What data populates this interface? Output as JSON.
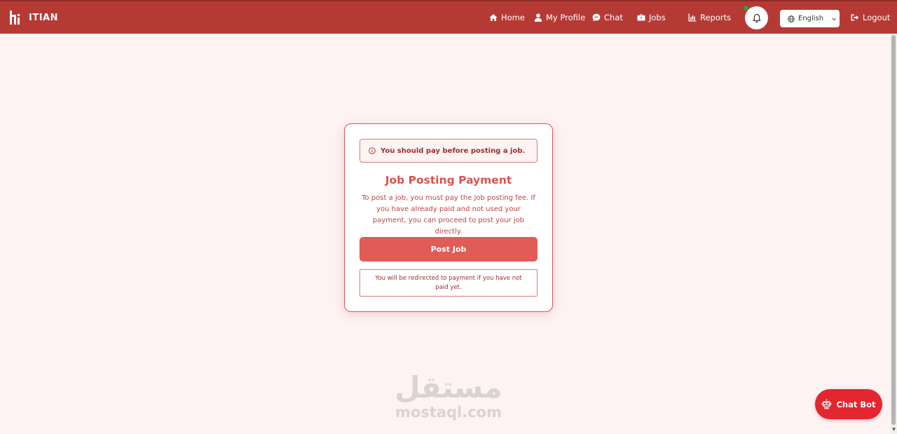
{
  "navbar": {
    "brand": "ITIAN",
    "links": [
      {
        "label": "Home",
        "icon": "home-icon"
      },
      {
        "label": "My Profile",
        "icon": "user-icon"
      },
      {
        "label": "Chat",
        "icon": "chat-icon"
      },
      {
        "label": "Jobs",
        "icon": "briefcase-icon"
      },
      {
        "label": "Reports",
        "icon": "chart-icon"
      }
    ],
    "language": "English",
    "logout": "Logout"
  },
  "card": {
    "alert": "You should pay before posting a job.",
    "title": "Job Posting Payment",
    "description": "To post a job, you must pay the job posting fee. If you have already paid and not used your payment, you can proceed to post your job directly.",
    "post_button": "Post Job",
    "redirect_note": "You will be redirected to payment if you have not paid yet."
  },
  "watermark": {
    "arabic": "مستقل",
    "latin": "mostaql.com"
  },
  "chatbot": {
    "label": "Chat Bot"
  },
  "colors": {
    "navbar": "#b63a34",
    "accent": "#d9534f",
    "button": "#e05d57",
    "chatbot": "#e3262f",
    "online": "#2ea043"
  }
}
